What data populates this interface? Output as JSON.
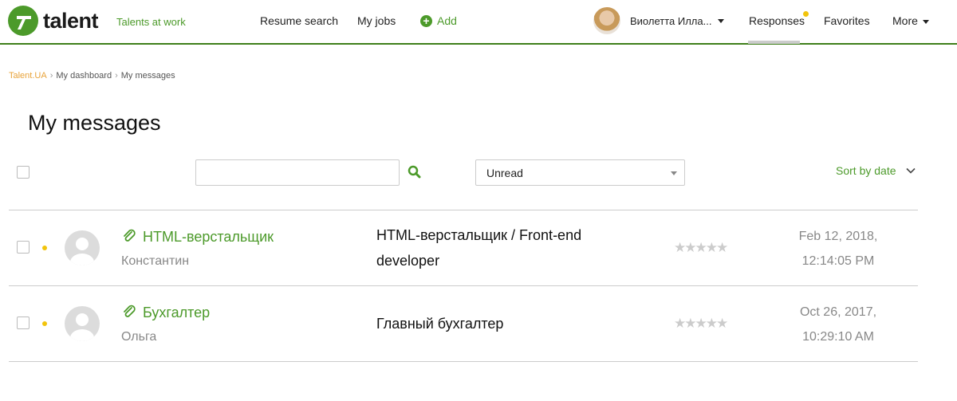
{
  "header": {
    "logo_text": "talent",
    "tagline": "Talents at work",
    "nav": {
      "resume_search": "Resume search",
      "my_jobs": "My jobs",
      "add": "Add"
    },
    "user_name": "Виолетта Илла...",
    "responses": "Responses",
    "favorites": "Favorites",
    "more": "More"
  },
  "breadcrumb": {
    "home": "Talent.UA",
    "dashboard": "My dashboard",
    "current": "My messages"
  },
  "page_title": "My messages",
  "toolbar": {
    "search_value": "",
    "filter_value": "Unread",
    "sort_label": "Sort by date"
  },
  "messages": [
    {
      "title": "HTML-верстальщик",
      "sender": "Константин",
      "vacancy": "HTML-верстальщик / Front-end developer",
      "rating": "★★★★★",
      "date": "Feb 12, 2018,",
      "time": "12:14:05 PM"
    },
    {
      "title": "Бухгалтер",
      "sender": "Ольга",
      "vacancy": "Главный бухгалтер",
      "rating": "★★★★★",
      "date": "Oct 26, 2017,",
      "time": "10:29:10 AM"
    }
  ],
  "colors": {
    "brand_green": "#4c9a2a",
    "unread_dot": "#f2c40c",
    "breadcrumb_home": "#e8a33a"
  }
}
